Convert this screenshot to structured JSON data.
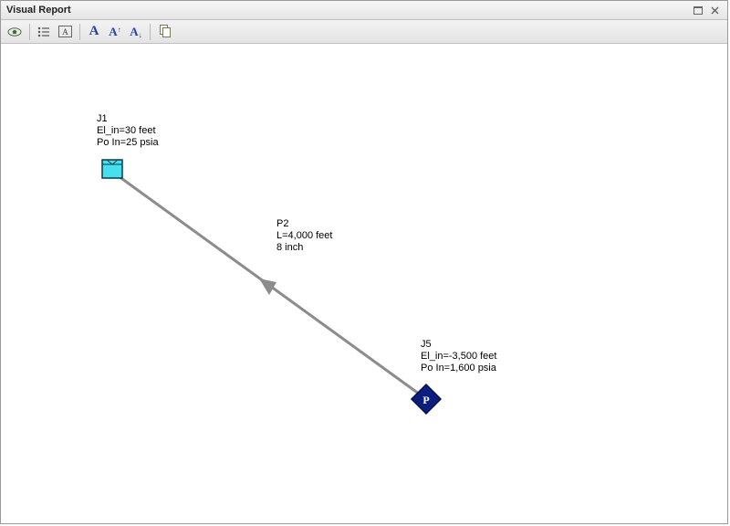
{
  "window": {
    "title": "Visual Report"
  },
  "toolbar": {
    "icons": {
      "eye": "eye-icon",
      "list": "list-icon",
      "textbox": "textbox-icon",
      "font_normal": "A",
      "font_increase_base": "A",
      "font_increase_sup": "↑",
      "font_decrease_base": "A",
      "font_decrease_sub": "↓",
      "copy": "copy-icon"
    }
  },
  "diagram": {
    "nodes": {
      "j1": {
        "id": "J1",
        "line2": "El_in=30 feet",
        "line3": "Po In=25 psia",
        "type": "tank"
      },
      "j5": {
        "id": "J5",
        "line2": "El_in=-3,500 feet",
        "line3": "Po In=1,600 psia",
        "type": "pressure",
        "symbol": "P"
      }
    },
    "pipe": {
      "id": "P2",
      "line2": "L=4,000 feet",
      "line3": "8 inch"
    },
    "colors": {
      "tank_fill": "#49e0ee",
      "pressure_fill": "#0c1d80",
      "pipe_stroke": "#8c8c8c"
    }
  }
}
